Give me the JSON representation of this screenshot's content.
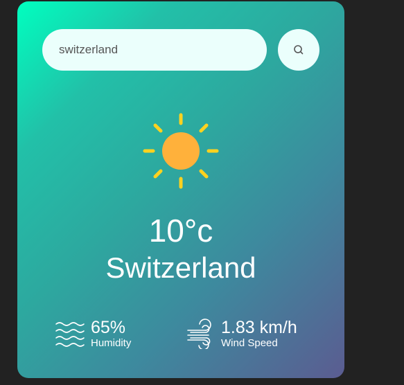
{
  "search": {
    "value": "switzerland",
    "placeholder": "",
    "button_icon": "search-icon"
  },
  "weather": {
    "icon": "sun-icon",
    "temperature": "10°c",
    "city": "Switzerland"
  },
  "details": {
    "humidity": {
      "icon": "humidity-icon",
      "value": "65%",
      "label": "Humidity"
    },
    "wind": {
      "icon": "wind-icon",
      "value": "1.83 km/h",
      "label": "Wind Speed"
    }
  },
  "colors": {
    "background": "#222222",
    "gradient_start": "#00ffbf",
    "gradient_end": "#5b5c91",
    "input_background": "#ebfffc",
    "sun_core": "#ffb13b",
    "sun_rays": "#ffd21f"
  }
}
